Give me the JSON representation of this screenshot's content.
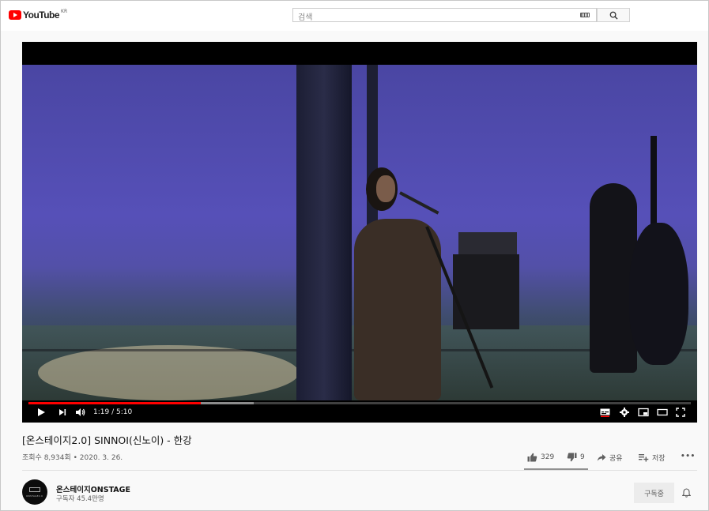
{
  "header": {
    "logo_text": "YouTube",
    "logo_region": "KR",
    "search_placeholder": "검색"
  },
  "player": {
    "time_display": "1:19 / 5:10",
    "played_fraction": 0.26,
    "buffered_fraction": 0.34,
    "accent_color": "#ff0000"
  },
  "video": {
    "title": "[온스테이지2.0] SINNOI(신노이) - 한강",
    "views_date": "조회수 8,934회 • 2020. 3. 26.",
    "like_count": "329",
    "dislike_count": "9",
    "share_label": "공유",
    "save_label": "저장",
    "more_label": "•••"
  },
  "channel": {
    "name": "온스테이지ONSTAGE",
    "subscribers": "구독자 45.4만명",
    "avatar_text": "ONSTAGE2.0",
    "subscribe_label": "구독중"
  }
}
